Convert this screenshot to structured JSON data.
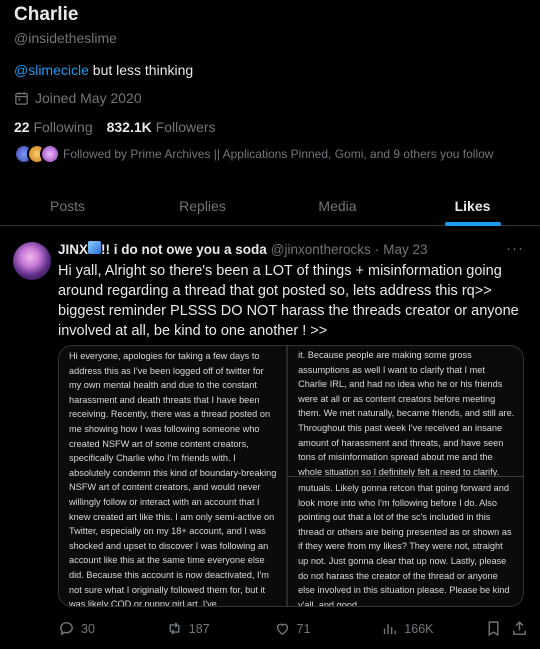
{
  "profile": {
    "name": "Charlie",
    "handle": "@insidetheslime",
    "bio_mention": "@slimecicle",
    "bio_rest": " but less thinking",
    "joined": "Joined May 2020",
    "following_count": "22",
    "following_label": "Following",
    "followers_count": "832.1K",
    "followers_label": "Followers",
    "followed_by": "Followed by Prime Archives || Applications Pinned, Gomi, and 9 others you follow"
  },
  "tabs": [
    {
      "label": "Posts"
    },
    {
      "label": "Replies"
    },
    {
      "label": "Media"
    },
    {
      "label": "Likes"
    }
  ],
  "tweet": {
    "display_name_a": "JINX",
    "display_name_b": "!! i do not owe you a soda",
    "handle": "@jinxontherocks",
    "separator": "·",
    "date": "May 23",
    "more": "···",
    "text": "Hi yall, Alright so there's been a LOT of things + misinformation going around regarding a thread that got posted so, lets address this rq>> biggest reminder PLSSS DO NOT harass the threads creator or anyone involved at all, be kind to one another ! >>",
    "image_left": "Hi everyone, apologies for taking a few days to address this as I've been logged off of twitter for my own mental health and due to the constant harassment and death threats that I have been receiving. Recently, there was a thread posted on me showing how I was following someone who created NSFW art of some content creators, specifically Charlie who I'm friends with. I absolutely condemn this kind of boundary-breaking NSFW art of content creators, and would never willingly follow or interact with an account that I knew created art like this. I am only semi-active on Twitter, especially on my 18+ account, and I was shocked and upset to discover I was following an account like this at the same time everyone else did. Because this account is now deactivated, I'm not sure what I originally followed them for, but it was likely COD or puppy girl art. I've",
    "image_right_top": "it. Because people are making some gross assumptions as well I want to clarify that I met Charlie IRL, and had no idea who he or his friends were at all or as content creators before meeting them. We met naturally, became friends, and still are. Throughout this past week I've received an insane amount of harassment and threats, and have seen tons of misinformation spread about me and the whole situation so I definitely felt a need to clarify.",
    "image_right_bottom": "mutuals. Likely gonna retcon that going forward and look more into who I'm following before I do. Also pointing out that a lot of the sc's included in this thread or others are being presented as or shown as if they were from my likes? They were not, straight up not. Just gonna clear that up now. Lastly, please do not harass the creator of the thread or anyone else involved in this situation please. Please be kind y'all, and good",
    "replies": "30",
    "reposts": "187",
    "likes": "71",
    "views": "166K"
  },
  "colors": {
    "accent": "#1d9bf0",
    "muted": "#71767b",
    "text": "#e7e9ea",
    "bg": "#000000"
  }
}
